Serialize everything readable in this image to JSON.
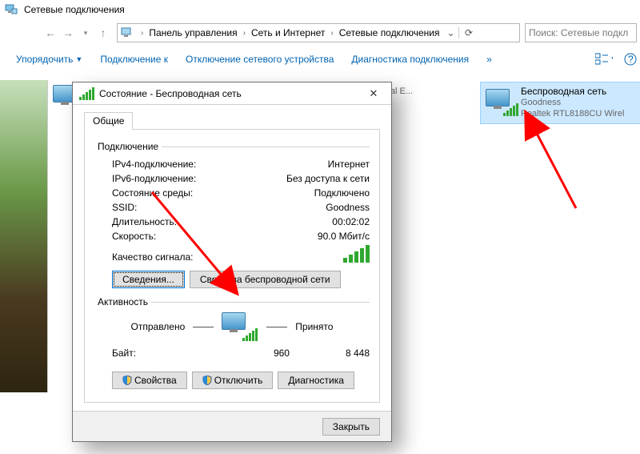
{
  "window": {
    "title": "Сетевые подключения"
  },
  "breadcrumb": {
    "items": [
      "Панель управления",
      "Сеть и Интернет",
      "Сетевые подключения"
    ]
  },
  "search": {
    "placeholder": "Поиск: Сетевые подкл"
  },
  "toolbar": {
    "organize": "Упорядочить",
    "connect": "Подключение к",
    "disable": "Отключение сетевого устройства",
    "diagnose": "Диагностика подключения",
    "more": "»"
  },
  "connections": [
    {
      "name": "",
      "line2": "",
      "line3": "chi Virtual E..."
    },
    {
      "name": "Беспроводная сеть",
      "line2": "Goodness",
      "line3": "Realtek RTL8188CU Wirel"
    }
  ],
  "dialog": {
    "title": "Состояние - Беспроводная сеть",
    "tab_general": "Общие",
    "group_conn": "Подключение",
    "ipv4_label": "IPv4-подключение:",
    "ipv4_value": "Интернет",
    "ipv6_label": "IPv6-подключение:",
    "ipv6_value": "Без доступа к сети",
    "media_label": "Состояние среды:",
    "media_value": "Подключено",
    "ssid_label": "SSID:",
    "ssid_value": "Goodness",
    "duration_label": "Длительность:",
    "duration_value": "00:02:02",
    "speed_label": "Скорость:",
    "speed_value": "90.0 Мбит/с",
    "signal_label": "Качество сигнала:",
    "details_btn": "Сведения...",
    "wprops_btn": "Свойства беспроводной сети",
    "group_activity": "Активность",
    "sent_label": "Отправлено",
    "recv_label": "Принято",
    "bytes_label": "Байт:",
    "bytes_sent": "960",
    "bytes_recv": "8 448",
    "props_btn": "Свойства",
    "disable_btn": "Отключить",
    "diag_btn": "Диагностика",
    "close_btn": "Закрыть"
  }
}
